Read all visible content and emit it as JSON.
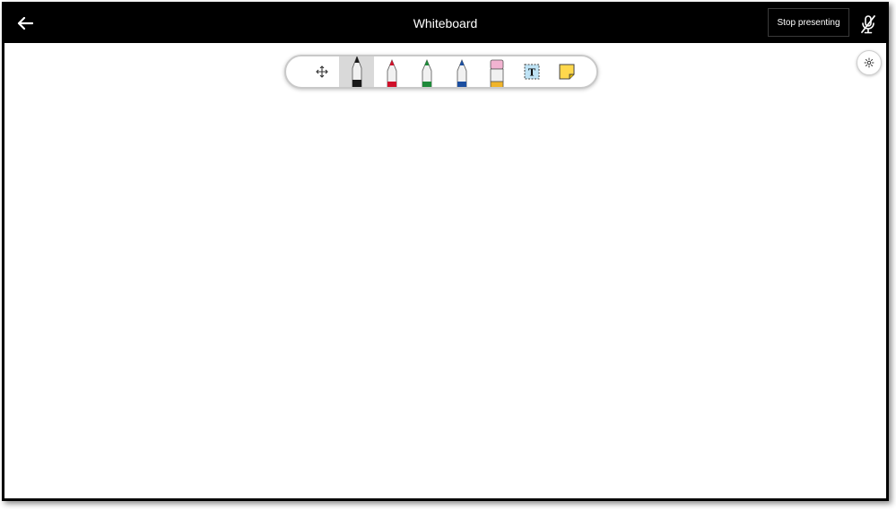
{
  "header": {
    "title": "Whiteboard",
    "stop_presenting_label": "Stop presenting",
    "back_icon": "arrow-left-icon",
    "mic_icon": "mic-off-icon"
  },
  "toolbar": {
    "selected_tool": "black-pen",
    "tools": [
      {
        "name": "move",
        "icon": "move-arrows-icon"
      },
      {
        "name": "black-pen",
        "icon": "pen-icon",
        "color": "#1a1a1a"
      },
      {
        "name": "red-pen",
        "icon": "pen-icon",
        "color": "#d0112b"
      },
      {
        "name": "green-pen",
        "icon": "pen-icon",
        "color": "#1f8a3a"
      },
      {
        "name": "blue-pen",
        "icon": "pen-icon",
        "color": "#1c4fa0"
      },
      {
        "name": "eraser",
        "icon": "eraser-icon",
        "color": "#f2b3d1"
      },
      {
        "name": "text-box",
        "icon": "text-box-icon",
        "label": "T"
      },
      {
        "name": "sticky-note",
        "icon": "sticky-note-icon",
        "color": "#ffd84d"
      }
    ]
  },
  "settings": {
    "icon": "gear-icon"
  },
  "colors": {
    "header_bg": "#000000",
    "canvas_bg": "#ffffff",
    "selected_tool_bg": "#d9d9d9"
  }
}
